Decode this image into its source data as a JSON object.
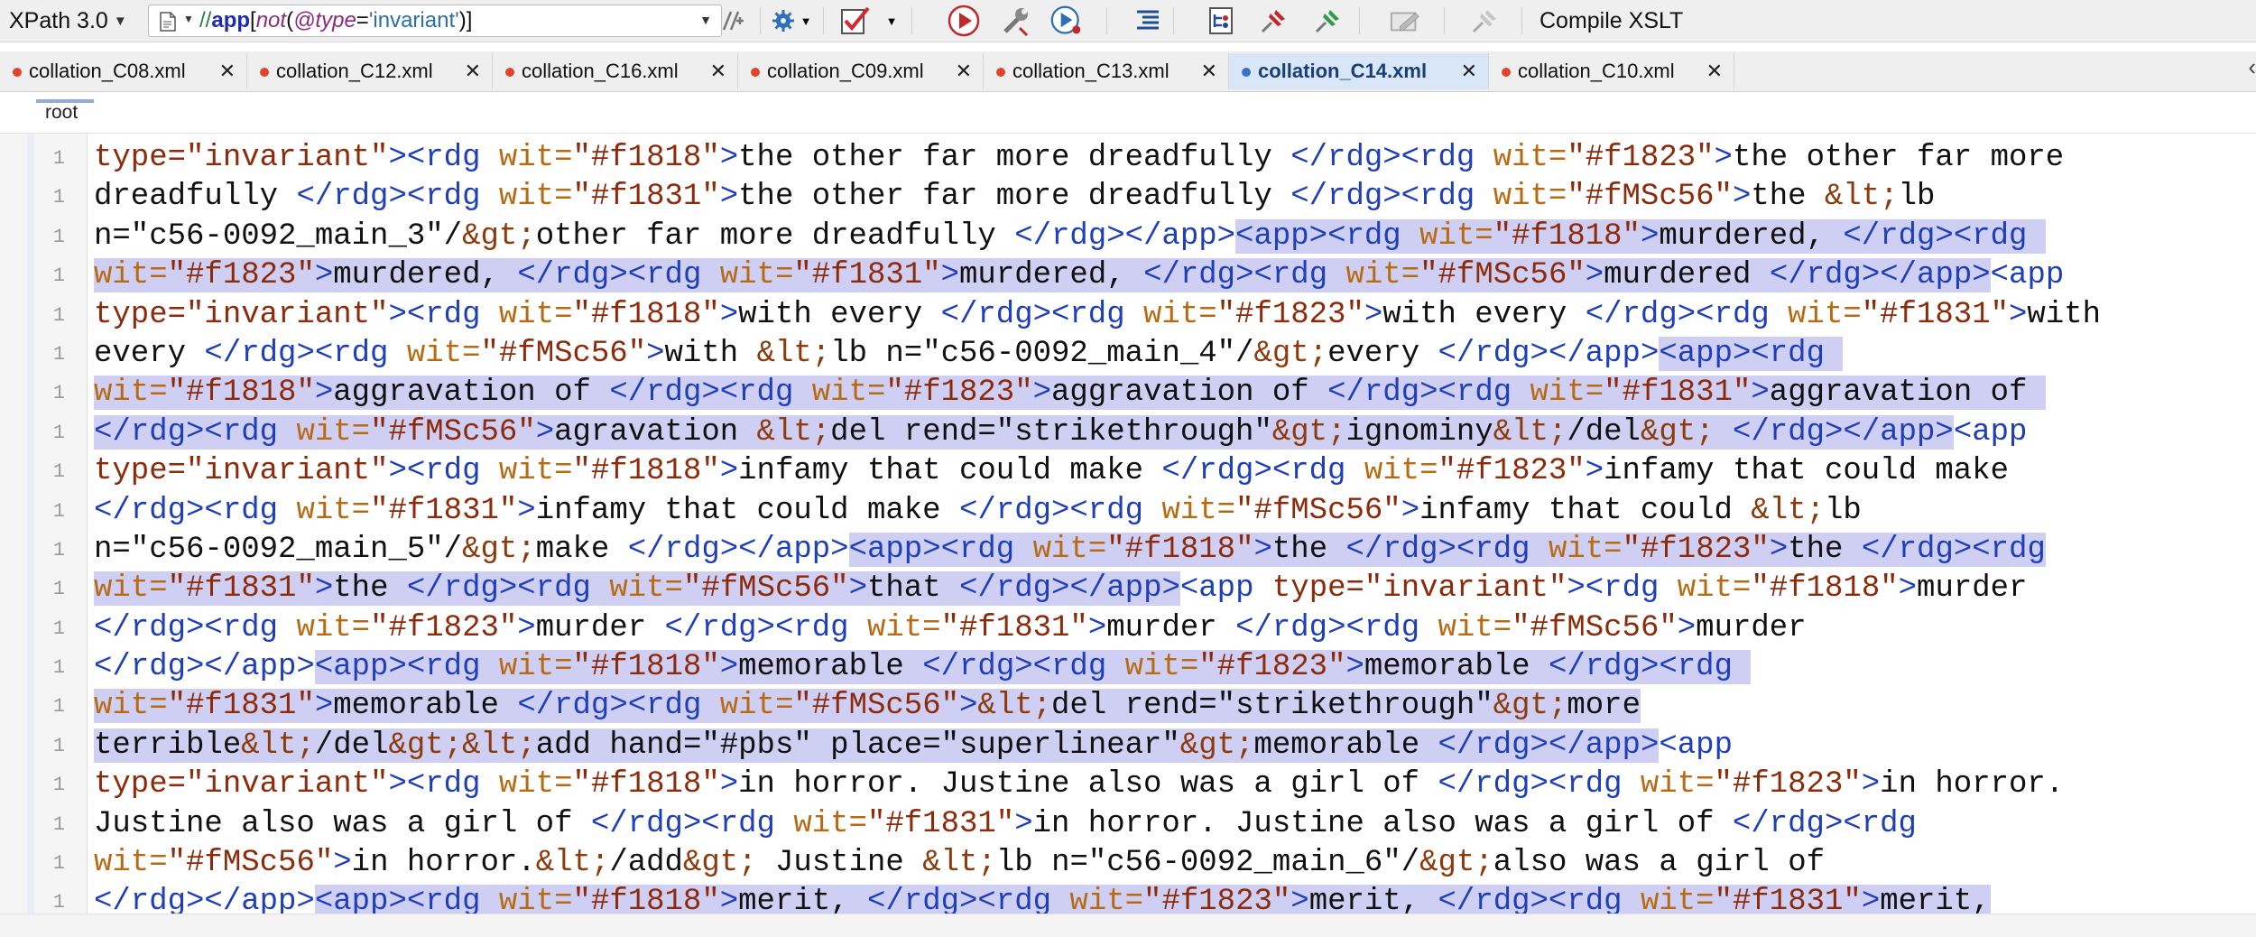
{
  "toolbar": {
    "xpath_version": "XPath 3.0",
    "xpath_expression": {
      "axis": "//",
      "element": "app",
      "open": "[",
      "fn": "not",
      "paren_open": "(",
      "attr": "@type",
      "eq": "=",
      "str": "'invariant'",
      "close": ")]"
    },
    "compile_label": "Compile XSLT",
    "icons": [
      "document-icon",
      "filter-settings-icon",
      "gear-icon",
      "validate-check-icon",
      "run-transform-icon",
      "wrench-icon",
      "debug-play-icon",
      "format-indent-icon",
      "xpath-tree-icon",
      "pin-red-icon",
      "pin-green-icon",
      "edit-pencil-icon",
      "pin-disabled-icon"
    ]
  },
  "tabs": [
    {
      "label": "collation_C08.xml",
      "active": false
    },
    {
      "label": "collation_C12.xml",
      "active": false
    },
    {
      "label": "collation_C16.xml",
      "active": false
    },
    {
      "label": "collation_C09.xml",
      "active": false
    },
    {
      "label": "collation_C13.xml",
      "active": false
    },
    {
      "label": "collation_C14.xml",
      "active": true
    },
    {
      "label": "collation_C10.xml",
      "active": false
    }
  ],
  "tab_close": "✕",
  "tabs_more": "‹",
  "breadcrumb": "root",
  "line_number": "1",
  "colors": {
    "tag": "#1f3fb8",
    "attribute": "#b86a12",
    "value": "#8c2a0a",
    "highlight": "#cfcff4"
  },
  "editor_lines": [
    [
      [
        "v",
        "type=\"invariant\""
      ],
      [
        "t",
        "><rdg "
      ],
      [
        "a",
        "wit="
      ],
      [
        "v",
        "\"#f1818\""
      ],
      [
        "t",
        ">"
      ],
      [
        "x",
        "the other far more dreadfully "
      ],
      [
        "t",
        "</rdg><rdg "
      ],
      [
        "a",
        "wit="
      ],
      [
        "v",
        "\"#f1823\""
      ],
      [
        "t",
        ">"
      ],
      [
        "x",
        "the other far more"
      ]
    ],
    [
      [
        "x",
        "dreadfully "
      ],
      [
        "t",
        "</rdg><rdg "
      ],
      [
        "a",
        "wit="
      ],
      [
        "v",
        "\"#f1831\""
      ],
      [
        "t",
        ">"
      ],
      [
        "x",
        "the other far more dreadfully "
      ],
      [
        "t",
        "</rdg><rdg "
      ],
      [
        "a",
        "wit="
      ],
      [
        "v",
        "\"#fMSc56\""
      ],
      [
        "t",
        ">"
      ],
      [
        "x",
        "the "
      ],
      [
        "e",
        "&lt;"
      ],
      [
        "x",
        "lb"
      ]
    ],
    [
      [
        "x",
        "n=\"c56-0092_main_3\"/"
      ],
      [
        "e",
        "&gt;"
      ],
      [
        "x",
        "other far more dreadfully "
      ],
      [
        "t",
        "</rdg></app>"
      ],
      [
        "h",
        "<app><rdg ",
        [
          "t"
        ]
      ],
      [
        "h",
        "wit=",
        [
          "a"
        ]
      ],
      [
        "h",
        "\"#f1818\"",
        [
          "v"
        ]
      ],
      [
        "h",
        ">",
        [
          "t"
        ]
      ],
      [
        "h",
        "murdered, ",
        [
          "x"
        ]
      ],
      [
        "h",
        "</rdg><rdg ",
        [
          "t"
        ]
      ]
    ],
    [
      [
        "h",
        "wit=",
        [
          "a"
        ]
      ],
      [
        "h",
        "\"#f1823\"",
        [
          "v"
        ]
      ],
      [
        "h",
        ">",
        [
          "t"
        ]
      ],
      [
        "h",
        "murdered, ",
        [
          "x"
        ]
      ],
      [
        "h",
        "</rdg><rdg ",
        [
          "t"
        ]
      ],
      [
        "h",
        "wit=",
        [
          "a"
        ]
      ],
      [
        "h",
        "\"#f1831\"",
        [
          "v"
        ]
      ],
      [
        "h",
        ">",
        [
          "t"
        ]
      ],
      [
        "h",
        "murdered, ",
        [
          "x"
        ]
      ],
      [
        "h",
        "</rdg><rdg ",
        [
          "t"
        ]
      ],
      [
        "h",
        "wit=",
        [
          "a"
        ]
      ],
      [
        "h",
        "\"#fMSc56\"",
        [
          "v"
        ]
      ],
      [
        "h",
        ">",
        [
          "t"
        ]
      ],
      [
        "h",
        "murdered ",
        [
          "x"
        ]
      ],
      [
        "h",
        "</rdg></app>",
        [
          "t"
        ]
      ],
      [
        "t",
        "<app"
      ]
    ],
    [
      [
        "v",
        "type=\"invariant\""
      ],
      [
        "t",
        "><rdg "
      ],
      [
        "a",
        "wit="
      ],
      [
        "v",
        "\"#f1818\""
      ],
      [
        "t",
        ">"
      ],
      [
        "x",
        "with every "
      ],
      [
        "t",
        "</rdg><rdg "
      ],
      [
        "a",
        "wit="
      ],
      [
        "v",
        "\"#f1823\""
      ],
      [
        "t",
        ">"
      ],
      [
        "x",
        "with every "
      ],
      [
        "t",
        "</rdg><rdg "
      ],
      [
        "a",
        "wit="
      ],
      [
        "v",
        "\"#f1831\""
      ],
      [
        "t",
        ">"
      ],
      [
        "x",
        "with"
      ]
    ],
    [
      [
        "x",
        "every "
      ],
      [
        "t",
        "</rdg><rdg "
      ],
      [
        "a",
        "wit="
      ],
      [
        "v",
        "\"#fMSc56\""
      ],
      [
        "t",
        ">"
      ],
      [
        "x",
        "with "
      ],
      [
        "e",
        "&lt;"
      ],
      [
        "x",
        "lb n=\"c56-0092_main_4\"/"
      ],
      [
        "e",
        "&gt;"
      ],
      [
        "x",
        "every "
      ],
      [
        "t",
        "</rdg></app>"
      ],
      [
        "h",
        "<app><rdg ",
        [
          "t"
        ]
      ]
    ],
    [
      [
        "h",
        "wit=",
        [
          "a"
        ]
      ],
      [
        "h",
        "\"#f1818\"",
        [
          "v"
        ]
      ],
      [
        "h",
        ">",
        [
          "t"
        ]
      ],
      [
        "h",
        "aggravation of ",
        [
          "x"
        ]
      ],
      [
        "h",
        "</rdg><rdg ",
        [
          "t"
        ]
      ],
      [
        "h",
        "wit=",
        [
          "a"
        ]
      ],
      [
        "h",
        "\"#f1823\"",
        [
          "v"
        ]
      ],
      [
        "h",
        ">",
        [
          "t"
        ]
      ],
      [
        "h",
        "aggravation of ",
        [
          "x"
        ]
      ],
      [
        "h",
        "</rdg><rdg ",
        [
          "t"
        ]
      ],
      [
        "h",
        "wit=",
        [
          "a"
        ]
      ],
      [
        "h",
        "\"#f1831\"",
        [
          "v"
        ]
      ],
      [
        "h",
        ">",
        [
          "t"
        ]
      ],
      [
        "h",
        "aggravation of ",
        [
          "x"
        ]
      ]
    ],
    [
      [
        "h",
        "</rdg><rdg ",
        [
          "t"
        ]
      ],
      [
        "h",
        "wit=",
        [
          "a"
        ]
      ],
      [
        "h",
        "\"#fMSc56\"",
        [
          "v"
        ]
      ],
      [
        "h",
        ">",
        [
          "t"
        ]
      ],
      [
        "h",
        "agravation ",
        [
          "x"
        ]
      ],
      [
        "h",
        "&lt;",
        [
          "e"
        ]
      ],
      [
        "h",
        "del rend=\"strikethrough\"",
        [
          "x"
        ]
      ],
      [
        "h",
        "&gt;",
        [
          "e"
        ]
      ],
      [
        "h",
        "ignominy",
        [
          "x"
        ]
      ],
      [
        "h",
        "&lt;",
        [
          "e"
        ]
      ],
      [
        "h",
        "/del",
        [
          "x"
        ]
      ],
      [
        "h",
        "&gt;",
        [
          "e"
        ]
      ],
      [
        "h",
        " ",
        [
          "x"
        ]
      ],
      [
        "h",
        "</rdg></app>",
        [
          "t"
        ]
      ],
      [
        "t",
        "<app"
      ]
    ],
    [
      [
        "v",
        "type=\"invariant\""
      ],
      [
        "t",
        "><rdg "
      ],
      [
        "a",
        "wit="
      ],
      [
        "v",
        "\"#f1818\""
      ],
      [
        "t",
        ">"
      ],
      [
        "x",
        "infamy that could make "
      ],
      [
        "t",
        "</rdg><rdg "
      ],
      [
        "a",
        "wit="
      ],
      [
        "v",
        "\"#f1823\""
      ],
      [
        "t",
        ">"
      ],
      [
        "x",
        "infamy that could make"
      ]
    ],
    [
      [
        "t",
        "</rdg><rdg "
      ],
      [
        "a",
        "wit="
      ],
      [
        "v",
        "\"#f1831\""
      ],
      [
        "t",
        ">"
      ],
      [
        "x",
        "infamy that could make "
      ],
      [
        "t",
        "</rdg><rdg "
      ],
      [
        "a",
        "wit="
      ],
      [
        "v",
        "\"#fMSc56\""
      ],
      [
        "t",
        ">"
      ],
      [
        "x",
        "infamy that could "
      ],
      [
        "e",
        "&lt;"
      ],
      [
        "x",
        "lb"
      ]
    ],
    [
      [
        "x",
        "n=\"c56-0092_main_5\"/"
      ],
      [
        "e",
        "&gt;"
      ],
      [
        "x",
        "make "
      ],
      [
        "t",
        "</rdg></app>"
      ],
      [
        "h",
        "<app><rdg ",
        [
          "t"
        ]
      ],
      [
        "h",
        "wit=",
        [
          "a"
        ]
      ],
      [
        "h",
        "\"#f1818\"",
        [
          "v"
        ]
      ],
      [
        "h",
        ">",
        [
          "t"
        ]
      ],
      [
        "h",
        "the ",
        [
          "x"
        ]
      ],
      [
        "h",
        "</rdg><rdg ",
        [
          "t"
        ]
      ],
      [
        "h",
        "wit=",
        [
          "a"
        ]
      ],
      [
        "h",
        "\"#f1823\"",
        [
          "v"
        ]
      ],
      [
        "h",
        ">",
        [
          "t"
        ]
      ],
      [
        "h",
        "the ",
        [
          "x"
        ]
      ],
      [
        "h",
        "</rdg><rdg",
        [
          "t"
        ]
      ]
    ],
    [
      [
        "h",
        "wit=",
        [
          "a"
        ]
      ],
      [
        "h",
        "\"#f1831\"",
        [
          "v"
        ]
      ],
      [
        "h",
        ">",
        [
          "t"
        ]
      ],
      [
        "h",
        "the ",
        [
          "x"
        ]
      ],
      [
        "h",
        "</rdg><rdg ",
        [
          "t"
        ]
      ],
      [
        "h",
        "wit=",
        [
          "a"
        ]
      ],
      [
        "h",
        "\"#fMSc56\"",
        [
          "v"
        ]
      ],
      [
        "h",
        ">",
        [
          "t"
        ]
      ],
      [
        "h",
        "that ",
        [
          "x"
        ]
      ],
      [
        "h",
        "</rdg></app>",
        [
          "t"
        ]
      ],
      [
        "t",
        "<app "
      ],
      [
        "v",
        "type=\"invariant\""
      ],
      [
        "t",
        "><rdg "
      ],
      [
        "a",
        "wit="
      ],
      [
        "v",
        "\"#f1818\""
      ],
      [
        "t",
        ">"
      ],
      [
        "x",
        "murder"
      ]
    ],
    [
      [
        "t",
        "</rdg><rdg "
      ],
      [
        "a",
        "wit="
      ],
      [
        "v",
        "\"#f1823\""
      ],
      [
        "t",
        ">"
      ],
      [
        "x",
        "murder "
      ],
      [
        "t",
        "</rdg><rdg "
      ],
      [
        "a",
        "wit="
      ],
      [
        "v",
        "\"#f1831\""
      ],
      [
        "t",
        ">"
      ],
      [
        "x",
        "murder "
      ],
      [
        "t",
        "</rdg><rdg "
      ],
      [
        "a",
        "wit="
      ],
      [
        "v",
        "\"#fMSc56\""
      ],
      [
        "t",
        ">"
      ],
      [
        "x",
        "murder"
      ]
    ],
    [
      [
        "t",
        "</rdg></app>"
      ],
      [
        "h",
        "<app><rdg ",
        [
          "t"
        ]
      ],
      [
        "h",
        "wit=",
        [
          "a"
        ]
      ],
      [
        "h",
        "\"#f1818\"",
        [
          "v"
        ]
      ],
      [
        "h",
        ">",
        [
          "t"
        ]
      ],
      [
        "h",
        "memorable ",
        [
          "x"
        ]
      ],
      [
        "h",
        "</rdg><rdg ",
        [
          "t"
        ]
      ],
      [
        "h",
        "wit=",
        [
          "a"
        ]
      ],
      [
        "h",
        "\"#f1823\"",
        [
          "v"
        ]
      ],
      [
        "h",
        ">",
        [
          "t"
        ]
      ],
      [
        "h",
        "memorable ",
        [
          "x"
        ]
      ],
      [
        "h",
        "</rdg><rdg ",
        [
          "t"
        ]
      ]
    ],
    [
      [
        "h",
        "wit=",
        [
          "a"
        ]
      ],
      [
        "h",
        "\"#f1831\"",
        [
          "v"
        ]
      ],
      [
        "h",
        ">",
        [
          "t"
        ]
      ],
      [
        "h",
        "memorable ",
        [
          "x"
        ]
      ],
      [
        "h",
        "</rdg><rdg ",
        [
          "t"
        ]
      ],
      [
        "h",
        "wit=",
        [
          "a"
        ]
      ],
      [
        "h",
        "\"#fMSc56\"",
        [
          "v"
        ]
      ],
      [
        "h",
        ">",
        [
          "t"
        ]
      ],
      [
        "h",
        "&lt;",
        [
          "e"
        ]
      ],
      [
        "h",
        "del rend=\"strikethrough\"",
        [
          "x"
        ]
      ],
      [
        "h",
        "&gt;",
        [
          "e"
        ]
      ],
      [
        "h",
        "more",
        [
          "x"
        ]
      ]
    ],
    [
      [
        "h",
        "terrible",
        [
          "x"
        ]
      ],
      [
        "h",
        "&lt;",
        [
          "e"
        ]
      ],
      [
        "h",
        "/del",
        [
          "x"
        ]
      ],
      [
        "h",
        "&gt;&lt;",
        [
          "e"
        ]
      ],
      [
        "h",
        "add hand=\"#pbs\" place=\"superlinear\"",
        [
          "x"
        ]
      ],
      [
        "h",
        "&gt;",
        [
          "e"
        ]
      ],
      [
        "h",
        "memorable ",
        [
          "x"
        ]
      ],
      [
        "h",
        "</rdg></app>",
        [
          "t"
        ]
      ],
      [
        "t",
        "<app"
      ]
    ],
    [
      [
        "v",
        "type=\"invariant\""
      ],
      [
        "t",
        "><rdg "
      ],
      [
        "a",
        "wit="
      ],
      [
        "v",
        "\"#f1818\""
      ],
      [
        "t",
        ">"
      ],
      [
        "x",
        "in horror. Justine also was a girl of "
      ],
      [
        "t",
        "</rdg><rdg "
      ],
      [
        "a",
        "wit="
      ],
      [
        "v",
        "\"#f1823\""
      ],
      [
        "t",
        ">"
      ],
      [
        "x",
        "in horror."
      ]
    ],
    [
      [
        "x",
        "Justine also was a girl of "
      ],
      [
        "t",
        "</rdg><rdg "
      ],
      [
        "a",
        "wit="
      ],
      [
        "v",
        "\"#f1831\""
      ],
      [
        "t",
        ">"
      ],
      [
        "x",
        "in horror. Justine also was a girl of "
      ],
      [
        "t",
        "</rdg><rdg"
      ]
    ],
    [
      [
        "a",
        "wit="
      ],
      [
        "v",
        "\"#fMSc56\""
      ],
      [
        "t",
        ">"
      ],
      [
        "x",
        "in horror."
      ],
      [
        "e",
        "&lt;"
      ],
      [
        "x",
        "/add"
      ],
      [
        "e",
        "&gt;"
      ],
      [
        "x",
        " Justine "
      ],
      [
        "e",
        "&lt;"
      ],
      [
        "x",
        "lb n=\"c56-0092_main_6\"/"
      ],
      [
        "e",
        "&gt;"
      ],
      [
        "x",
        "also was a girl of"
      ]
    ],
    [
      [
        "t",
        "</rdg></app>"
      ],
      [
        "h",
        "<app><rdg ",
        [
          "t"
        ]
      ],
      [
        "h",
        "wit=",
        [
          "a"
        ]
      ],
      [
        "h",
        "\"#f1818\"",
        [
          "v"
        ]
      ],
      [
        "h",
        ">",
        [
          "t"
        ]
      ],
      [
        "h",
        "merit, ",
        [
          "x"
        ]
      ],
      [
        "h",
        "</rdg><rdg ",
        [
          "t"
        ]
      ],
      [
        "h",
        "wit=",
        [
          "a"
        ]
      ],
      [
        "h",
        "\"#f1823\"",
        [
          "v"
        ]
      ],
      [
        "h",
        ">",
        [
          "t"
        ]
      ],
      [
        "h",
        "merit, ",
        [
          "x"
        ]
      ],
      [
        "h",
        "</rdg><rdg ",
        [
          "t"
        ]
      ],
      [
        "h",
        "wit=",
        [
          "a"
        ]
      ],
      [
        "h",
        "\"#f1831\"",
        [
          "v"
        ]
      ],
      [
        "h",
        ">",
        [
          "t"
        ]
      ],
      [
        "h",
        "merit,",
        [
          "x"
        ]
      ]
    ]
  ]
}
